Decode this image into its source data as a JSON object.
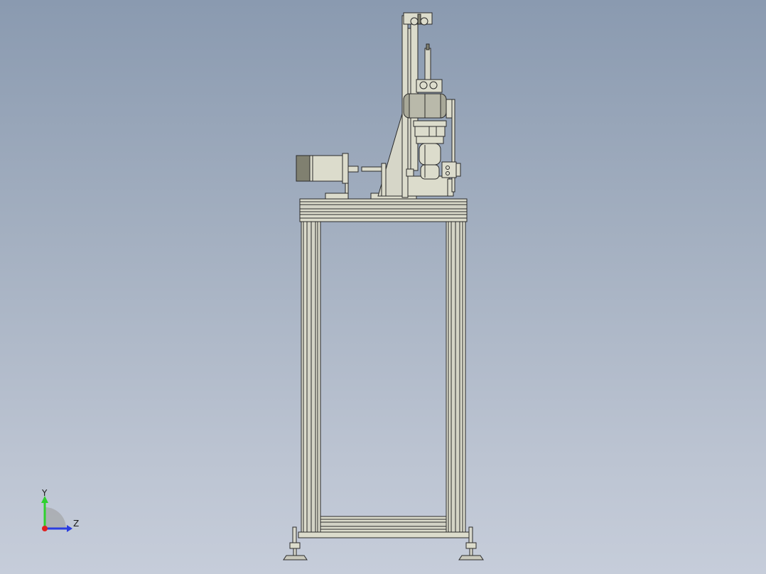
{
  "scene": {
    "background_top": "#8a9ab0",
    "background_bottom": "#c6cdda",
    "part_color": "#dcdccc",
    "edge_color": "#2a2a2a"
  },
  "triad": {
    "y_label": "Y",
    "z_label": "Z",
    "y_color": "#2fd12f",
    "z_color": "#2a3de0",
    "x_color": "#e02020"
  }
}
